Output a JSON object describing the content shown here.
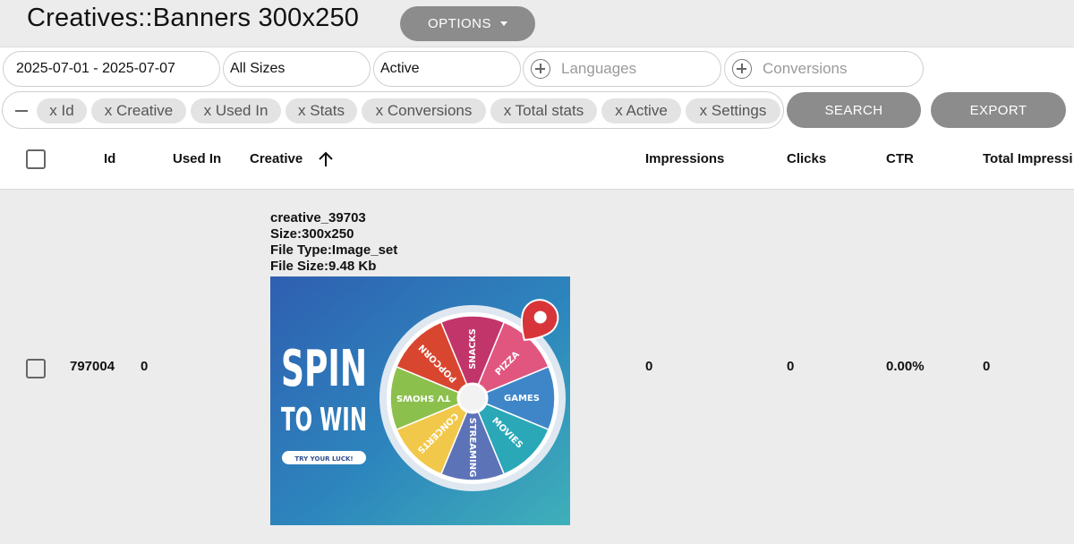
{
  "page": {
    "title": "Creatives::Banners 300x250",
    "options_label": "OPTIONS"
  },
  "filters": {
    "date_range": "2025-07-01 - 2025-07-07",
    "size": "All Sizes",
    "status": "Active",
    "languages_placeholder": "Languages",
    "conversions_placeholder": "Conversions"
  },
  "chips": [
    "x Id",
    "x Creative",
    "x Used In",
    "x Stats",
    "x Conversions",
    "x Total stats",
    "x Active",
    "x Settings"
  ],
  "actions": {
    "search_label": "SEARCH",
    "export_label": "EXPORT"
  },
  "table": {
    "columns": {
      "id": "Id",
      "used_in": "Used In",
      "creative": "Creative",
      "impressions": "Impressions",
      "clicks": "Clicks",
      "ctr": "CTR",
      "total_impressions": "Total Impressi"
    },
    "rows": [
      {
        "id": "797004",
        "used_in": "0",
        "creative_name": "creative_39703",
        "creative_size": "Size:300x250",
        "creative_type": "File Type:Image_set",
        "creative_file_size": "File Size:9.48 Kb",
        "impressions": "0",
        "clicks": "0",
        "ctr": "0.00%",
        "total_impressions": "0"
      }
    ]
  },
  "banner": {
    "headline_1": "SPIN",
    "headline_2": "TO WIN",
    "cta": "TRY YOUR LUCK!",
    "segments": [
      "PIZZA",
      "GAMES",
      "MOVIES",
      "STREAMING",
      "CONCERTS",
      "TV SHOWS",
      "POPCORN",
      "SNACKS"
    ],
    "segment_colors": [
      "#e0567f",
      "#3f86c9",
      "#2aa8b8",
      "#5c73b8",
      "#f2c84b",
      "#8cc04c",
      "#d9462f",
      "#c2356b"
    ]
  },
  "colors": {
    "button_gray": "#8c8c8c",
    "chip_bg": "#e3e3e3",
    "page_bg": "#ececec"
  }
}
